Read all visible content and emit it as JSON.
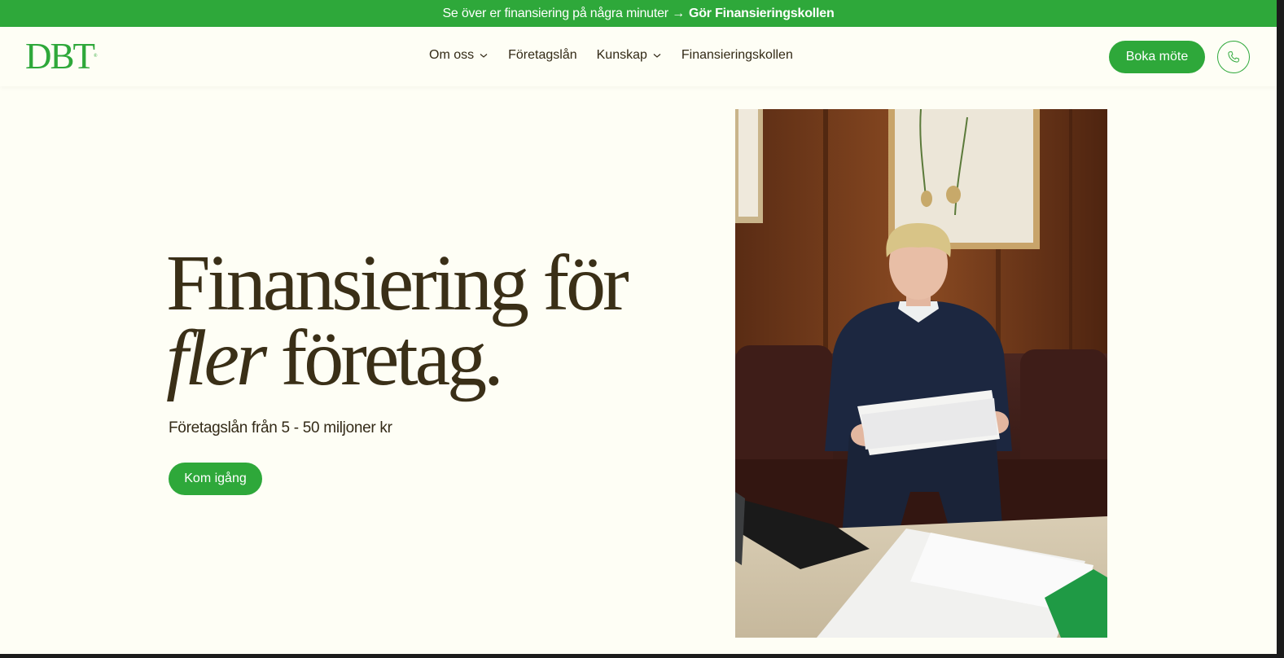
{
  "topbar": {
    "text": "Se över er finansiering på några minuter →",
    "link": "Gör Finansieringskollen"
  },
  "header": {
    "logo": "DBT",
    "nav": [
      {
        "label": "Om oss",
        "dropdown": true
      },
      {
        "label": "Företagslån",
        "dropdown": false
      },
      {
        "label": "Kunskap",
        "dropdown": true
      },
      {
        "label": "Finansieringskollen",
        "dropdown": false
      }
    ],
    "book_label": "Boka möte",
    "phone_icon": "phone-icon"
  },
  "hero": {
    "title_line1": "Finansiering för",
    "title_italic": "fler",
    "title_line2_rest": "företag.",
    "subtitle": "Företagslån från 5 - 50 miljoner kr",
    "cta_label": "Kom igång",
    "image": "photo of man reading documents on leather sofa"
  },
  "colors": {
    "brand_green": "#2ea83a",
    "background": "#fefef5",
    "text_dark": "#3a2f17"
  }
}
